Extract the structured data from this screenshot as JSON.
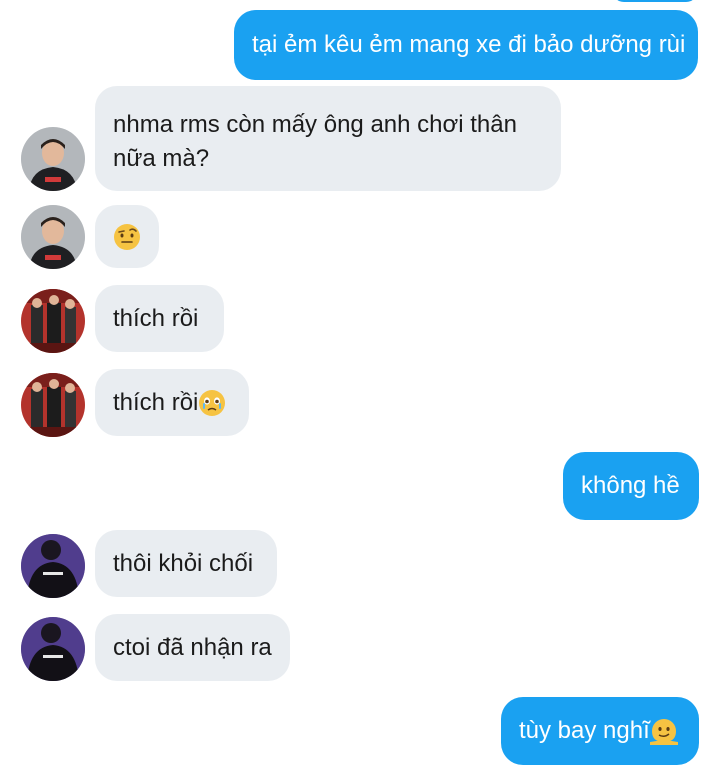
{
  "messages": [
    {
      "side": "out",
      "text": "tại ẻm kêu ẻm mang xe đi bảo dưỡng rùi"
    },
    {
      "side": "in",
      "avatar": "player-a-avatar",
      "text": "nhma rms còn mấy ông anh chơi thân nữa mà?"
    },
    {
      "side": "in",
      "avatar": "player-a-avatar",
      "emoji": "raised-eyebrow-face-emoji"
    },
    {
      "side": "in",
      "avatar": "group-photo-avatar",
      "text": "thích rồi"
    },
    {
      "side": "in",
      "avatar": "group-photo-avatar",
      "text": "thích rồi",
      "emoji": "face-holding-back-tears-emoji"
    },
    {
      "side": "out",
      "text": "không hề"
    },
    {
      "side": "in",
      "avatar": "back-jersey-avatar",
      "text": "thôi khỏi chối"
    },
    {
      "side": "in",
      "avatar": "back-jersey-avatar",
      "text": "ctoi đã nhận ra"
    },
    {
      "side": "out",
      "text": "tùy bay nghĩ",
      "emoji": "melting-face-emoji"
    }
  ],
  "colors": {
    "outgoing_bubble": "#1aa1f1",
    "incoming_bubble": "#e9edf1",
    "incoming_text": "#1b1b1b"
  }
}
